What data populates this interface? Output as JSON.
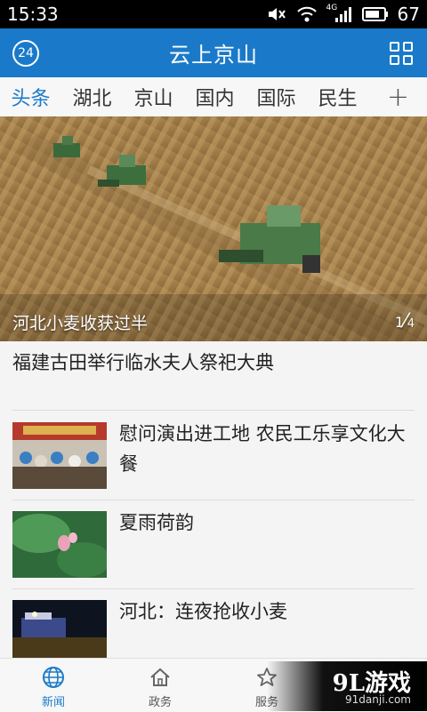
{
  "status_bar": {
    "time": "15:33",
    "network": "4G",
    "battery": "67",
    "icons": [
      "mute-icon",
      "wifi-icon",
      "signal-icon",
      "battery-icon"
    ]
  },
  "header": {
    "badge": "24",
    "title": "云上京山",
    "grid_icon": "grid-menu-icon"
  },
  "tabs": {
    "items": [
      "头条",
      "湖北",
      "京山",
      "国内",
      "国际",
      "民生"
    ],
    "active": "头条",
    "add_label": "+"
  },
  "hero": {
    "caption": "河北小麦收获过半",
    "pager_current": "1",
    "pager_total": "4"
  },
  "headline": "福建古田举行临水夫人祭祀大典",
  "news_list": [
    {
      "title": "慰问演出进工地 农民工乐享文化大餐"
    },
    {
      "title": "夏雨荷韵"
    },
    {
      "title": "河北：连夜抢收小麦"
    }
  ],
  "bottom_nav": {
    "items": [
      {
        "label": "新闻",
        "icon": "globe-icon"
      },
      {
        "label": "政务",
        "icon": "home-icon"
      },
      {
        "label": "服务",
        "icon": "star-icon"
      }
    ],
    "active": "新闻"
  },
  "watermark": {
    "brand": "9L游戏",
    "site": "91danji.com"
  },
  "colors": {
    "accent": "#1a7ac9",
    "status_bar": "#000000"
  }
}
